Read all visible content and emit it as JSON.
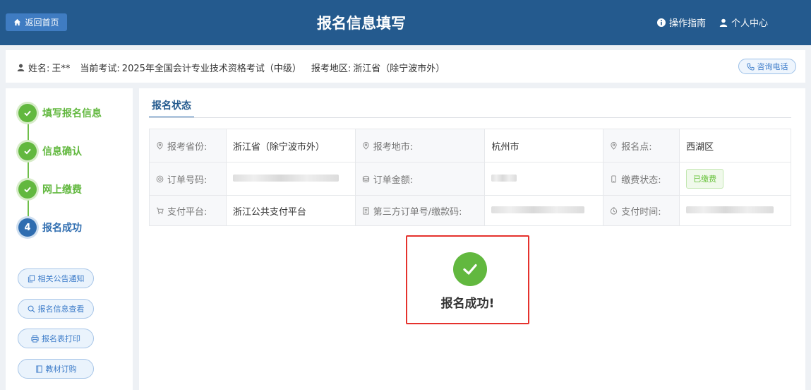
{
  "header": {
    "home_label": "返回首页",
    "title": "报名信息填写",
    "guide_label": "操作指南",
    "profile_label": "个人中心"
  },
  "infobar": {
    "name_label": "姓名:",
    "name_value": "王**",
    "exam_label": "当前考试:",
    "exam_value": "2025年全国会计专业技术资格考试（中级）",
    "region_label": "报考地区:",
    "region_value": "浙江省（除宁波市外）",
    "consult_label": "咨询电话"
  },
  "steps": [
    {
      "label": "填写报名信息",
      "state": "done"
    },
    {
      "label": "信息确认",
      "state": "done"
    },
    {
      "label": "网上缴费",
      "state": "done"
    },
    {
      "label": "报名成功",
      "state": "current",
      "number": "4"
    }
  ],
  "side_buttons": [
    {
      "label": "相关公告通知",
      "icon": "copy-icon"
    },
    {
      "label": "报名信息查看",
      "icon": "search-icon"
    },
    {
      "label": "报名表打印",
      "icon": "printer-icon"
    },
    {
      "label": "教材订购",
      "icon": "book-icon"
    }
  ],
  "main": {
    "tab_label": "报名状态",
    "rows": [
      [
        {
          "label": "报考省份:",
          "icon": "location-icon",
          "value": "浙江省（除宁波市外）"
        },
        {
          "label": "报考地市:",
          "icon": "location-icon",
          "value": "杭州市"
        },
        {
          "label": "报名点:",
          "icon": "location-icon",
          "value": "西湖区"
        }
      ],
      [
        {
          "label": "订单号码:",
          "icon": "order-icon",
          "value": ""
        },
        {
          "label": "订单金额:",
          "icon": "coins-icon",
          "value": ""
        },
        {
          "label": "缴费状态:",
          "icon": "phone-icon",
          "value": "已缴费"
        }
      ],
      [
        {
          "label": "支付平台:",
          "icon": "cart-icon",
          "value": "浙江公共支付平台"
        },
        {
          "label": "第三方订单号/缴款码:",
          "icon": "document-icon",
          "value": ""
        },
        {
          "label": "支付时间:",
          "icon": "clock-icon",
          "value": ""
        }
      ]
    ],
    "success_text": "报名成功!"
  },
  "colors": {
    "header_bg": "#245a8e",
    "step_done": "#62b83f",
    "step_current": "#2f6db0",
    "highlight_border": "#e5322d"
  }
}
